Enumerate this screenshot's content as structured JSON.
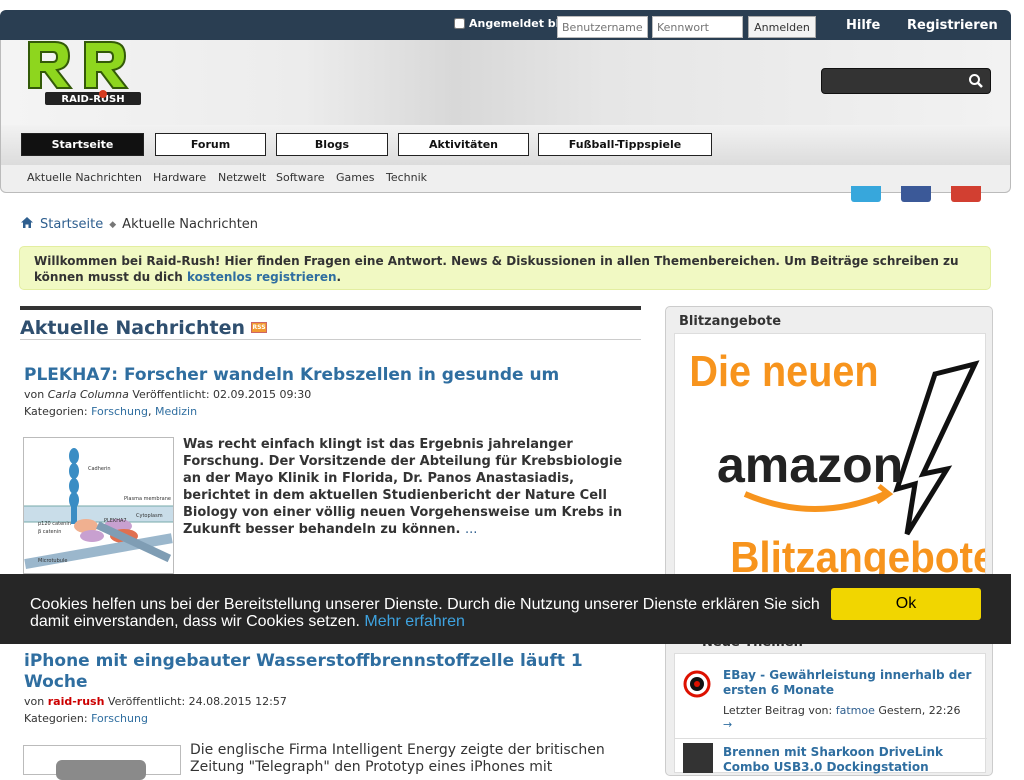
{
  "topbar": {
    "remember_label": "Angemeldet bleiben?",
    "username_placeholder": "Benutzername",
    "password_placeholder": "Kennwort",
    "login_button": "Anmelden",
    "help_link": "Hilfe",
    "register_link": "Registrieren"
  },
  "logo": {
    "text": "RAID-RUSH"
  },
  "nav": {
    "items": [
      {
        "label": "Startseite"
      },
      {
        "label": "Forum"
      },
      {
        "label": "Blogs"
      },
      {
        "label": "Aktivitäten"
      },
      {
        "label": "Fußball-Tippspiele"
      }
    ]
  },
  "subnav": {
    "items": [
      {
        "label": "Aktuelle Nachrichten"
      },
      {
        "label": "Hardware"
      },
      {
        "label": "Netzwelt"
      },
      {
        "label": "Software"
      },
      {
        "label": "Games"
      },
      {
        "label": "Technik"
      }
    ]
  },
  "breadcrumb": {
    "home": "Startseite",
    "current": "Aktuelle Nachrichten"
  },
  "welcome": {
    "text": "Willkommen bei Raid-Rush! Hier finden Fragen eine Antwort. News & Diskussionen in allen Themenbereichen. Um Beiträge schreiben zu können musst du dich ",
    "link": "kostenlos registrieren",
    "end": "."
  },
  "main": {
    "heading": "Aktuelle Nachrichten",
    "articles": [
      {
        "title": "PLEKHA7: Forscher wandeln Krebszellen in gesunde um",
        "by": "von",
        "author": "Carla Columna",
        "published": "Veröffentlicht: 02.09.2015 09:30",
        "cat_label": "Kategorien:",
        "cats": [
          "Forschung",
          "Medizin"
        ],
        "excerpt": "Was recht einfach klingt ist das Ergebnis jahrelanger Forschung. Der Vorsitzende der Abteilung für Krebsbiologie an der Mayo Klinik in Florida, Dr. Panos Anastasiadis, berichtet in dem aktuellen Studienbericht der Nature Cell Biology von einer völlig neuen Vorgehensweise um Krebs in Zukunft besser behandeln zu können.",
        "more": "..."
      },
      {
        "title": "iPhone mit eingebauter Wasserstoffbrennstoffzelle läuft 1 Woche",
        "by": "von",
        "author": "raid-rush",
        "published": "Veröffentlicht: 24.08.2015 12:57",
        "cat_label": "Kategorien:",
        "cats": [
          "Forschung"
        ],
        "excerpt": "Die englische Firma Intelligent Energy zeigte der britischen Zeitung \"Telegraph\" den Prototyp eines iPhones mit"
      }
    ],
    "diagram_labels": [
      "Cadherin",
      "Plasma membrane",
      "Cytoplasm",
      "p120 catenin",
      "β catenin",
      "PLEKHA7",
      "Microtubule"
    ]
  },
  "sidebar": {
    "title": "Blitzangebote",
    "ad": {
      "line1": "Die neuen",
      "line2": "amazon",
      "line3": "Blitzangebote!"
    },
    "threads_title": "Neue Themen",
    "threads": [
      {
        "title": "EBay - Gewährleistung innerhalb der ersten 6 Monate",
        "last_label": "Letzter Beitrag von:",
        "user": "fatmoe",
        "time": "Gestern, 22:26",
        "arrow": "→"
      },
      {
        "title": "Brennen mit Sharkoon DriveLink Combo USB3.0 Dockingstation"
      }
    ]
  },
  "cookie": {
    "text": "Cookies helfen uns bei der Bereitstellung unserer Dienste. Durch die Nutzung unserer Dienste erklären Sie sich damit einverstanden, dass wir Cookies setzen.",
    "link": "Mehr erfahren",
    "ok": "Ok"
  },
  "colors": {
    "accent": "#2f6ea0",
    "topbar": "#2a3e52",
    "cookie_button": "#f1d600",
    "logo_green": "#8ed61e",
    "ad_orange": "#f7941d"
  }
}
